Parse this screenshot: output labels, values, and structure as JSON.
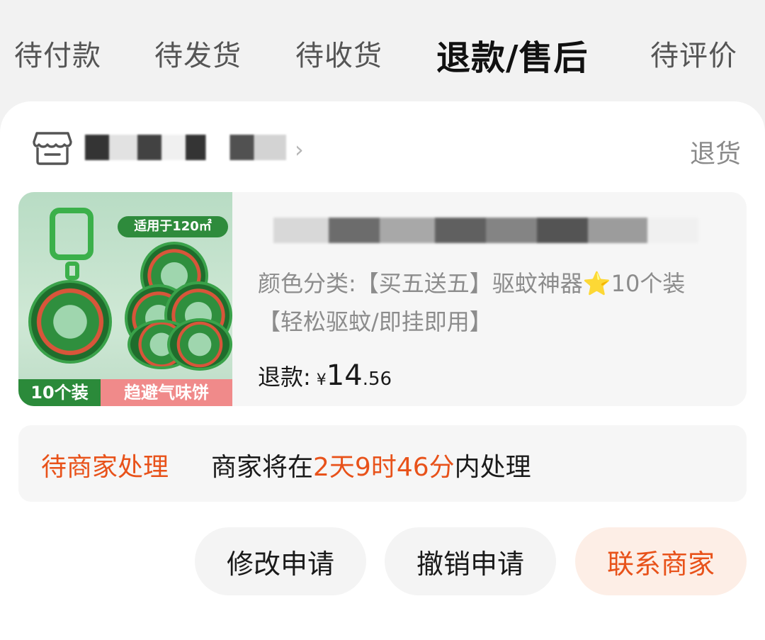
{
  "tabs": [
    {
      "label": "待付款"
    },
    {
      "label": "待发货"
    },
    {
      "label": "待收货"
    },
    {
      "label": "退款/售后"
    },
    {
      "label": "待评价"
    }
  ],
  "shop": {
    "return_type": "退货",
    "icon": "store-icon",
    "chevron": "›"
  },
  "product": {
    "spec": "颜色分类:【买五送五】驱蚊神器⭐10个装【轻松驱蚊/即挂即用】",
    "image": {
      "badge": "适用于120㎡",
      "footer_left": "10个装",
      "footer_right": "趋避气味饼"
    },
    "refund_label": "退款:",
    "currency": "¥",
    "price_int": "14",
    "price_dec": ".56"
  },
  "status": {
    "label": "待商家处理",
    "prefix": "商家将在",
    "time": "2天9时46分",
    "suffix": "内处理"
  },
  "actions": {
    "modify": "修改申请",
    "cancel": "撤销申请",
    "contact": "联系商家"
  },
  "colors": {
    "accent": "#e8521a",
    "accent_bg": "#fdeee6"
  }
}
